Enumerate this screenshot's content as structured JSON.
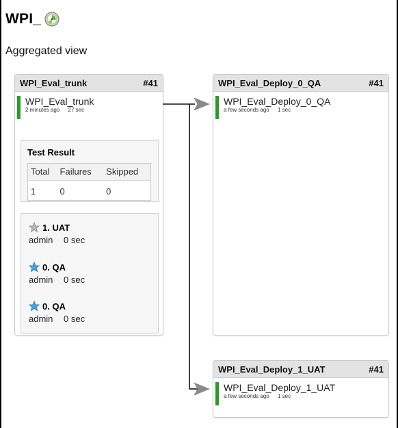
{
  "page": {
    "title": "WPI_",
    "subtitle": "Aggregated view"
  },
  "colors": {
    "success": "#2a9a2a",
    "header_bg": "#e3e3e3"
  },
  "cards": [
    {
      "name": "WPI_Eval_trunk",
      "number": "#41",
      "build_name": "WPI_Eval_trunk",
      "time_ago": "2 minutes ago",
      "duration": "27 sec",
      "test_result": {
        "title": "Test Result",
        "headers": [
          "Total",
          "Failures",
          "Skipped"
        ],
        "values": [
          "1",
          "0",
          "0"
        ]
      },
      "promotions": [
        {
          "label": "1. UAT",
          "user": "admin",
          "duration": "0 sec",
          "icon": "star-gray-icon"
        },
        {
          "label": "0. QA",
          "user": "admin",
          "duration": "0 sec",
          "icon": "star-blue-icon"
        },
        {
          "label": "0. QA",
          "user": "admin",
          "duration": "0 sec",
          "icon": "star-blue-icon"
        }
      ]
    },
    {
      "name": "WPI_Eval_Deploy_0_QA",
      "number": "#41",
      "build_name": "WPI_Eval_Deploy_0_QA",
      "time_ago": "a few seconds ago",
      "duration": "1 sec"
    },
    {
      "name": "WPI_Eval_Deploy_1_UAT",
      "number": "#41",
      "build_name": "WPI_Eval_Deploy_1_UAT",
      "time_ago": "a few seconds ago",
      "duration": "1 sec"
    }
  ]
}
